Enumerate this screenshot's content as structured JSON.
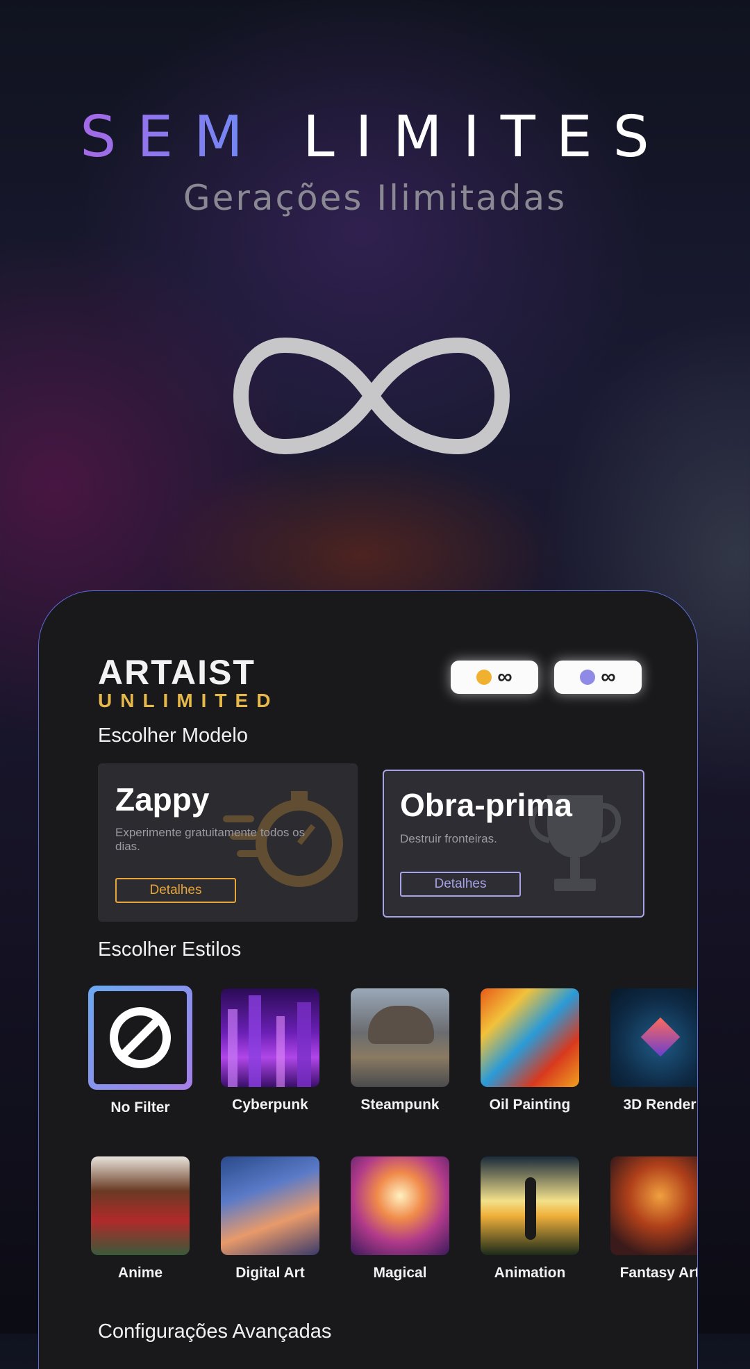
{
  "hero": {
    "title_accent": "SEM",
    "title_rest": "LIMITES",
    "subtitle": "Gerações Ilimitadas"
  },
  "app": {
    "logo_top": "ARTAIST",
    "logo_bottom": "UNLIMITED",
    "credits": [
      {
        "icon": "gold-coin-icon",
        "value": "∞"
      },
      {
        "icon": "violet-coin-icon",
        "value": "∞"
      }
    ]
  },
  "models": {
    "title": "Escolher Modelo",
    "items": [
      {
        "name": "Zappy",
        "description": "Experimente gratuitamente todos os dias.",
        "button": "Detalhes",
        "accent": "#e8a53a"
      },
      {
        "name": "Obra-prima",
        "description": "Destruir fronteiras.",
        "button": "Detalhes",
        "accent": "#a7a3e6"
      }
    ]
  },
  "styles": {
    "title": "Escolher Estilos",
    "row1": [
      "No Filter",
      "Cyberpunk",
      "Steampunk",
      "Oil Painting",
      "3D Render"
    ],
    "row2": [
      "Anime",
      "Digital Art",
      "Magical",
      "Animation",
      "Fantasy Art"
    ]
  },
  "advanced": {
    "title": "Configurações Avançadas"
  },
  "colors": {
    "accent_purple": "#a568e6",
    "accent_blue": "#6c8cf5",
    "gold": "#e8a53a",
    "card_bg": "#19191c"
  }
}
